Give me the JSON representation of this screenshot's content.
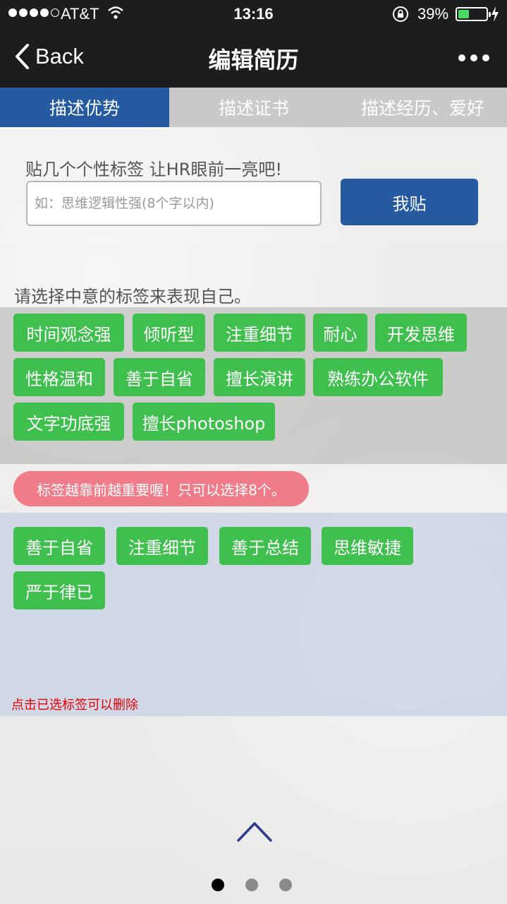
{
  "status_bar": {
    "carrier": "AT&T",
    "time": "13:16",
    "battery_percent": "39%",
    "battery_level": 0.39
  },
  "nav": {
    "back_label": "Back",
    "title": "编辑简历"
  },
  "tabs": [
    {
      "label": "描述优势",
      "active": true
    },
    {
      "label": "描述证书",
      "active": false
    },
    {
      "label": "描述经历、爱好",
      "active": false
    }
  ],
  "custom_tag": {
    "prompt": "贴几个个性标签 让HR眼前一亮吧!",
    "placeholder": "如：思维逻辑性强(8个字以内)",
    "value": "",
    "button_label": "我贴"
  },
  "available_tags": {
    "label": "请选择中意的标签来表现自己。",
    "items": [
      "时间观念强",
      "倾听型",
      "注重细节",
      "耐心",
      "开发思维",
      "性格温和",
      "善于自省",
      "擅长演讲",
      "熟练办公软件",
      "文字功底强",
      "擅长photoshop"
    ]
  },
  "hint": "标签越靠前越重要喔！只可以选择8个。",
  "selected_tags": {
    "items": [
      "善于自省",
      "注重细节",
      "善于总结",
      "思维敏捷",
      "严于律已"
    ],
    "delete_hint": "点击已选标签可以删除"
  },
  "pager": {
    "total": 3,
    "current": 1
  },
  "colors": {
    "primary": "#255aa0",
    "tag_green": "#3fbf4d",
    "hint_pink": "#f07c89",
    "warning_red": "#e60000",
    "bar_dark": "#1d1d1f"
  }
}
